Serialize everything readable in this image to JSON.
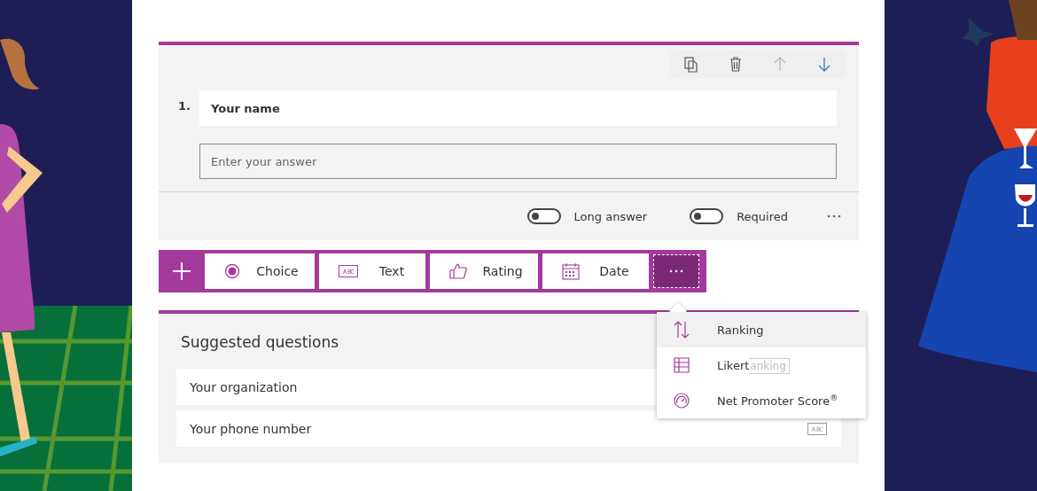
{
  "question_card": {
    "actions": [
      {
        "kind": "copy",
        "disabled": false
      },
      {
        "kind": "delete",
        "disabled": false
      },
      {
        "kind": "move_up",
        "disabled": true
      },
      {
        "kind": "move_down",
        "disabled": false
      }
    ],
    "number": "1.",
    "title": "Your name",
    "answer_placeholder": "Enter your answer",
    "toggles": [
      {
        "label": "Long answer",
        "on": false
      },
      {
        "label": "Required",
        "on": false
      }
    ]
  },
  "add_bar": {
    "types": [
      {
        "label": "Choice",
        "kind": "choice"
      },
      {
        "label": "Text",
        "kind": "text"
      },
      {
        "label": "Rating",
        "kind": "rating"
      },
      {
        "label": "Date",
        "kind": "date"
      }
    ]
  },
  "suggested": {
    "title": "Suggested questions",
    "items": [
      {
        "label": "Your organization"
      },
      {
        "label": "Your phone number",
        "hovered": true
      }
    ]
  },
  "more_menu": {
    "items": [
      {
        "label": "Ranking",
        "kind": "ranking",
        "selected": true
      },
      {
        "label": "Likert",
        "kind": "likert",
        "selected": false
      },
      {
        "label": "Net Promoter Score$^{®}$",
        "kind": "nps",
        "selected": false
      }
    ],
    "tooltip": "anking"
  }
}
